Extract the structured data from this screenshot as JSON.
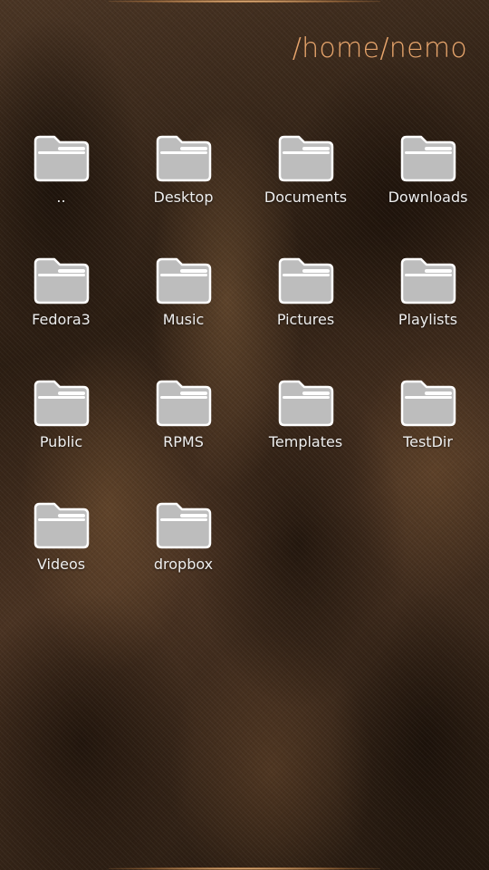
{
  "header": {
    "path": "/home/nemo"
  },
  "colors": {
    "accent": "#e7a56c",
    "folder_fill": "#bdbdbd",
    "folder_stroke": "#ffffff",
    "label": "#eeeeee"
  },
  "files": [
    {
      "label": "..",
      "icon": "folder-icon"
    },
    {
      "label": "Desktop",
      "icon": "folder-icon"
    },
    {
      "label": "Documents",
      "icon": "folder-icon"
    },
    {
      "label": "Downloads",
      "icon": "folder-icon"
    },
    {
      "label": "Fedora3",
      "icon": "folder-icon"
    },
    {
      "label": "Music",
      "icon": "folder-icon"
    },
    {
      "label": "Pictures",
      "icon": "folder-icon"
    },
    {
      "label": "Playlists",
      "icon": "folder-icon"
    },
    {
      "label": "Public",
      "icon": "folder-icon"
    },
    {
      "label": "RPMS",
      "icon": "folder-icon"
    },
    {
      "label": "Templates",
      "icon": "folder-icon"
    },
    {
      "label": "TestDir",
      "icon": "folder-icon"
    },
    {
      "label": "Videos",
      "icon": "folder-icon"
    },
    {
      "label": "dropbox",
      "icon": "folder-icon"
    }
  ]
}
